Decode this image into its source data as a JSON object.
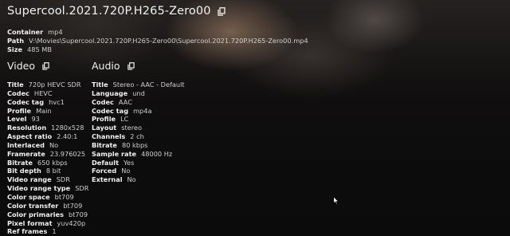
{
  "file": {
    "title": "Supercool.2021.720P.H265-Zero00",
    "meta": [
      {
        "key": "Container",
        "value": "mp4"
      },
      {
        "key": "Path",
        "value": "V:\\Movies\\Supercool.2021.720P.H265-Zero00\\Supercool.2021.720P.H265-Zero00.mp4"
      },
      {
        "key": "Size",
        "value": "485 MB"
      }
    ]
  },
  "video": {
    "heading": "Video",
    "rows": [
      {
        "key": "Title",
        "value": "720p HEVC SDR"
      },
      {
        "key": "Codec",
        "value": "HEVC"
      },
      {
        "key": "Codec tag",
        "value": "hvc1"
      },
      {
        "key": "Profile",
        "value": "Main"
      },
      {
        "key": "Level",
        "value": "93"
      },
      {
        "key": "Resolution",
        "value": "1280x528"
      },
      {
        "key": "Aspect ratio",
        "value": "2.40:1"
      },
      {
        "key": "Interlaced",
        "value": "No"
      },
      {
        "key": "Framerate",
        "value": "23.976025"
      },
      {
        "key": "Bitrate",
        "value": "650 kbps"
      },
      {
        "key": "Bit depth",
        "value": "8 bit"
      },
      {
        "key": "Video range",
        "value": "SDR"
      },
      {
        "key": "Video range type",
        "value": "SDR"
      },
      {
        "key": "Color space",
        "value": "bt709"
      },
      {
        "key": "Color transfer",
        "value": "bt709"
      },
      {
        "key": "Color primaries",
        "value": "bt709"
      },
      {
        "key": "Pixel format",
        "value": "yuv420p"
      },
      {
        "key": "Ref frames",
        "value": "1"
      }
    ]
  },
  "audio": {
    "heading": "Audio",
    "rows": [
      {
        "key": "Title",
        "value": "Stereo - AAC - Default"
      },
      {
        "key": "Language",
        "value": "und"
      },
      {
        "key": "Codec",
        "value": "AAC"
      },
      {
        "key": "Codec tag",
        "value": "mp4a"
      },
      {
        "key": "Profile",
        "value": "LC"
      },
      {
        "key": "Layout",
        "value": "stereo"
      },
      {
        "key": "Channels",
        "value": "2 ch"
      },
      {
        "key": "Bitrate",
        "value": "80 kbps"
      },
      {
        "key": "Sample rate",
        "value": "48000 Hz"
      },
      {
        "key": "Default",
        "value": "Yes"
      },
      {
        "key": "Forced",
        "value": "No"
      },
      {
        "key": "External",
        "value": "No"
      }
    ]
  },
  "icons": {
    "copy": "copy-icon",
    "cursor": "mouse-pointer-icon"
  }
}
